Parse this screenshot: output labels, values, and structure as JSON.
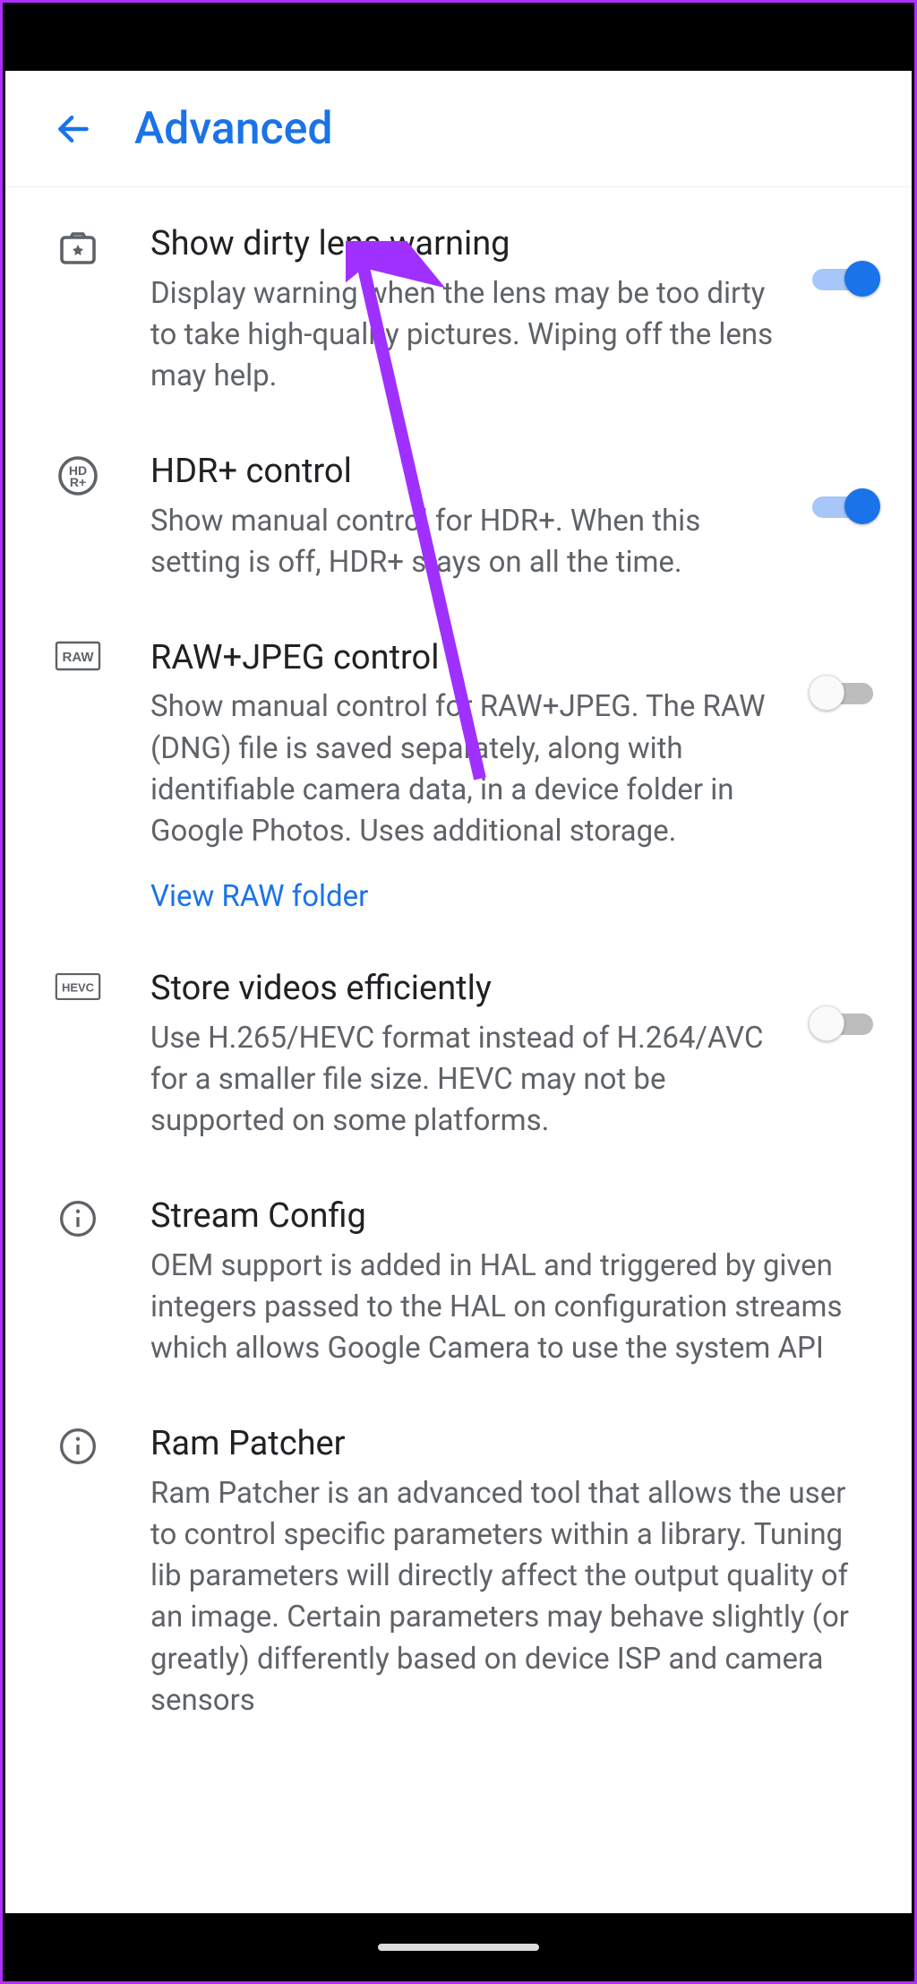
{
  "header": {
    "title": "Advanced"
  },
  "items": [
    {
      "icon": "camera-splat-icon",
      "title": "Show dirty lens warning",
      "desc": "Display warning when the lens may be too dirty to take high-quality pictures. Wiping off the lens may help.",
      "toggle": "on"
    },
    {
      "icon": "hdr-plus-icon",
      "title": "HDR+ control",
      "desc": "Show manual control for HDR+. When this setting is off, HDR+ stays on all the time.",
      "toggle": "on"
    },
    {
      "icon": "raw-icon",
      "title": "RAW+JPEG control",
      "desc": "Show manual control for RAW+JPEG. The RAW (DNG) file is saved separately, along with identifiable camera data, in a device folder in Google Photos. Uses additional storage.",
      "link": "View RAW folder",
      "toggle": "off"
    },
    {
      "icon": "hevc-icon",
      "title": "Store videos efficiently",
      "desc": "Use H.265/HEVC format instead of H.264/AVC for a smaller file size. HEVC may not be supported on some platforms.",
      "toggle": "off"
    },
    {
      "icon": "info-icon",
      "title": "Stream Config",
      "desc": "OEM support is added in HAL and triggered by given integers passed to the HAL on configuration streams which allows Google Camera to use the system API"
    },
    {
      "icon": "info-icon",
      "title": "Ram Patcher",
      "desc": "Ram Patcher is an advanced tool that allows the user to control specific parameters within a library. Tuning lib parameters will directly affect the output quality of an image. Certain parameters may behave slightly (or greatly) differently based on device ISP and camera sensors"
    }
  ]
}
